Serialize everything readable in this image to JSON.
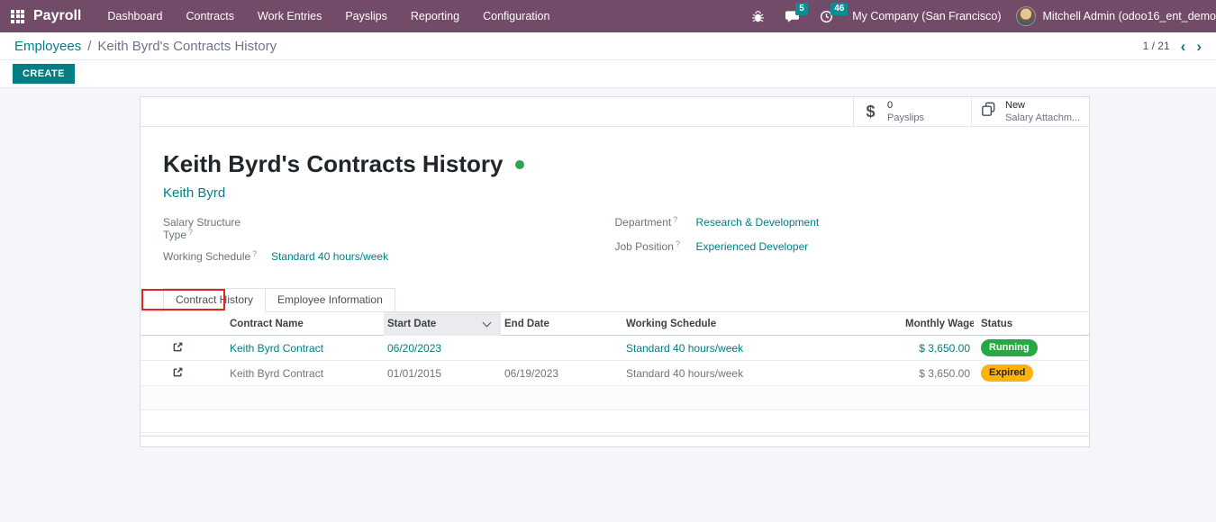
{
  "colors": {
    "navbar_bg": "#714B67",
    "accent_teal": "#017E84",
    "record_status_dot": "#2ea44f",
    "annotation_red": "#e5231d"
  },
  "navbar": {
    "app_name": "Payroll",
    "menu_items": [
      "Dashboard",
      "Contracts",
      "Work Entries",
      "Payslips",
      "Reporting",
      "Configuration"
    ],
    "messages_count": "5",
    "activities_count": "46",
    "company": "My Company (San Francisco)",
    "user": "Mitchell Admin (odoo16_ent_demo"
  },
  "breadcrumb": {
    "parent": "Employees",
    "separator": "/",
    "current": "Keith Byrd's Contracts History"
  },
  "pager": {
    "value": "1 / 21",
    "prev": "‹",
    "next": "›"
  },
  "actions": {
    "create_label": "CREATE"
  },
  "stat_buttons": {
    "payslips": {
      "icon_text": "$",
      "value": "0",
      "label": "Payslips"
    },
    "salary_attachments": {
      "value": "New",
      "label": "Salary Attachm..."
    }
  },
  "form": {
    "title": "Keith Byrd's Contracts History",
    "record_status_color": "#2ea44f",
    "employee": "Keith Byrd",
    "help_marker": "?",
    "fields": {
      "salary_structure_type": {
        "label": "Salary Structure Type",
        "value": ""
      },
      "working_schedule": {
        "label": "Working Schedule",
        "value": "Standard 40 hours/week"
      },
      "department": {
        "label": "Department",
        "value": "Research & Development"
      },
      "job_position": {
        "label": "Job Position",
        "value": "Experienced Developer"
      }
    },
    "tabs": [
      {
        "label": "Contract History",
        "active": true
      },
      {
        "label": "Employee Information",
        "active": false
      }
    ]
  },
  "annotation": {
    "color": "#e5231d",
    "target": "contract-history-tab"
  },
  "table": {
    "columns": [
      "Contract Name",
      "Start Date",
      "End Date",
      "Working Schedule",
      "Monthly Wage",
      "Status"
    ],
    "sorted_by": "Start Date",
    "rows": [
      {
        "contract_name": "Keith Byrd Contract",
        "start_date": "06/20/2023",
        "end_date": "",
        "working_schedule": "Standard 40 hours/week",
        "monthly_wage": "$ 3,650.00",
        "status": "Running",
        "status_bg": "#28a745",
        "status_fg": "#ffffff"
      },
      {
        "contract_name": "Keith Byrd Contract",
        "start_date": "01/01/2015",
        "end_date": "06/19/2023",
        "working_schedule": "Standard 40 hours/week",
        "monthly_wage": "$ 3,650.00",
        "status": "Expired",
        "status_bg": "#ffb10d",
        "status_fg": "#212529"
      }
    ]
  }
}
